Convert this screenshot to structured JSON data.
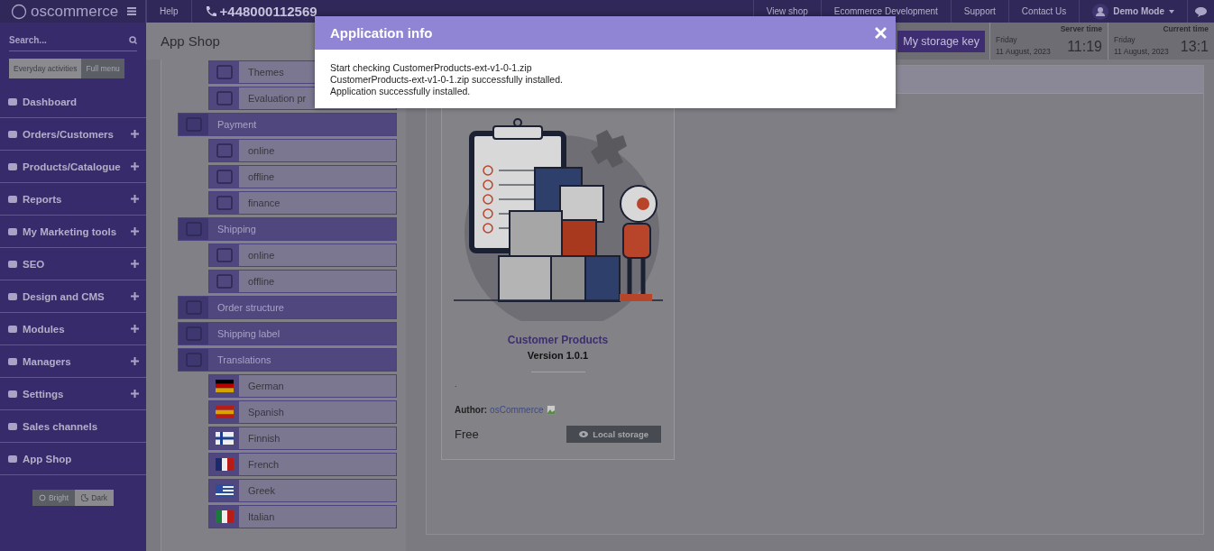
{
  "header": {
    "logo": "oscommerce",
    "help": "Help",
    "phone": "+448000112569",
    "links": [
      "View shop",
      "Ecommerce Development",
      "Support",
      "Contact Us"
    ],
    "user": "Demo Mode"
  },
  "sidebar": {
    "search": {
      "placeholder": "Search..."
    },
    "modes": [
      {
        "label": "Everyday activities",
        "selected": false
      },
      {
        "label": "Full menu",
        "selected": true
      }
    ],
    "items": [
      {
        "label": "Dashboard",
        "expandable": false
      },
      {
        "label": "Orders/Customers",
        "expandable": true
      },
      {
        "label": "Products/Catalogue",
        "expandable": true
      },
      {
        "label": "Reports",
        "expandable": true
      },
      {
        "label": "My Marketing tools",
        "expandable": true
      },
      {
        "label": "SEO",
        "expandable": true
      },
      {
        "label": "Design and CMS",
        "expandable": true
      },
      {
        "label": "Modules",
        "expandable": true
      },
      {
        "label": "Managers",
        "expandable": true
      },
      {
        "label": "Settings",
        "expandable": true
      },
      {
        "label": "Sales channels",
        "expandable": false
      },
      {
        "label": "App Shop",
        "expandable": false
      }
    ],
    "themes": [
      {
        "label": "Bright",
        "selected": true
      },
      {
        "label": "Dark",
        "selected": false
      }
    ]
  },
  "page": {
    "title": "App Shop",
    "storage_button": "My storage key",
    "clocks": [
      {
        "label": "Server time",
        "day": "Friday",
        "date": "11 August, 2023",
        "time": "11:19"
      },
      {
        "label": "Current time",
        "day": "Friday",
        "date": "11 August, 2023",
        "time": "13:1"
      }
    ]
  },
  "tree": [
    {
      "kind": "item",
      "label": "Themes"
    },
    {
      "kind": "item",
      "label": "Evaluation pr"
    },
    {
      "kind": "group",
      "label": "Payment",
      "children": [
        {
          "label": "online"
        },
        {
          "label": "offline"
        },
        {
          "label": "finance"
        }
      ]
    },
    {
      "kind": "group",
      "label": "Shipping",
      "children": [
        {
          "label": "online"
        },
        {
          "label": "offline"
        }
      ]
    },
    {
      "kind": "group",
      "label": "Order structure"
    },
    {
      "kind": "group",
      "label": "Shipping label"
    },
    {
      "kind": "group",
      "label": "Translations",
      "children": [
        {
          "label": "German"
        },
        {
          "label": "Spanish"
        },
        {
          "label": "Finnish"
        },
        {
          "label": "French"
        },
        {
          "label": "Greek"
        },
        {
          "label": "Italian"
        }
      ]
    }
  ],
  "card": {
    "title": "Customer Products",
    "version": "Version 1.0.1",
    "description": ".",
    "author_label": "Author:",
    "author": "osCommerce",
    "price": "Free",
    "button": "Local storage"
  },
  "modal": {
    "title": "Application info",
    "lines": [
      "Start checking CustomerProducts-ext-v1-0-1.zip",
      "CustomerProducts-ext-v1-0-1.zip successfully installed.",
      "Application successfully installed."
    ]
  }
}
